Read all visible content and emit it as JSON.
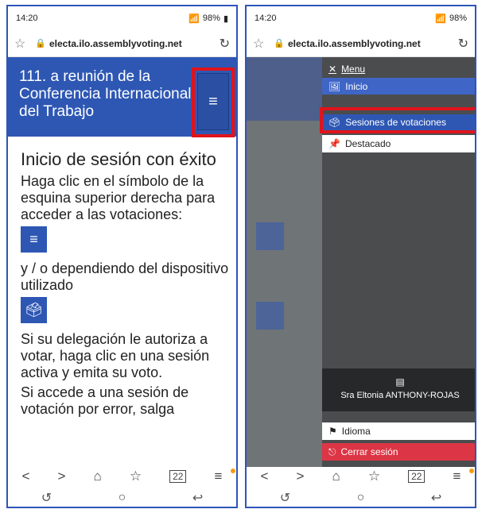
{
  "left": {
    "status": {
      "time": "14:20",
      "battery": "98%"
    },
    "url": "electa.ilo.assemblyvoting.net",
    "header_title": "111. a reunión de la Conferencia Internacional del Trabajo",
    "content": {
      "heading": "Inicio de sesión con éxito",
      "p1": "Haga clic en el símbolo de la esquina superior derecha para acceder a las votaciones:",
      "p2": "y / o dependiendo del dispositivo utilizado",
      "p3": "Si su delegación le autoriza a votar, haga clic en una sesión activa y emita su voto.",
      "p4": "Si accede a una sesión de votación por error, salga"
    }
  },
  "right": {
    "status": {
      "time": "14:20",
      "battery": "98%"
    },
    "url": "electa.ilo.assemblyvoting.net",
    "menu": {
      "title": "Menu",
      "inicio": "Inicio",
      "sesiones": "Sesiones de votaciones",
      "destacado": "Destacado",
      "user": "Sra Eltonia ANTHONY-ROJAS",
      "idioma": "Idioma",
      "cerrar": "Cerrar sesión"
    }
  },
  "nav": {
    "tabs_count": "22"
  },
  "colors": {
    "brand": "#2e57b4",
    "highlight": "#e0141b",
    "logout": "#dc3545"
  },
  "icons": [
    "star-icon",
    "lock-icon",
    "reload-icon",
    "menu-icon",
    "ballot-icon",
    "close-icon",
    "home-icon",
    "bookmark-icon",
    "tabs-icon",
    "flag-icon",
    "logout-icon",
    "user-card-icon"
  ]
}
